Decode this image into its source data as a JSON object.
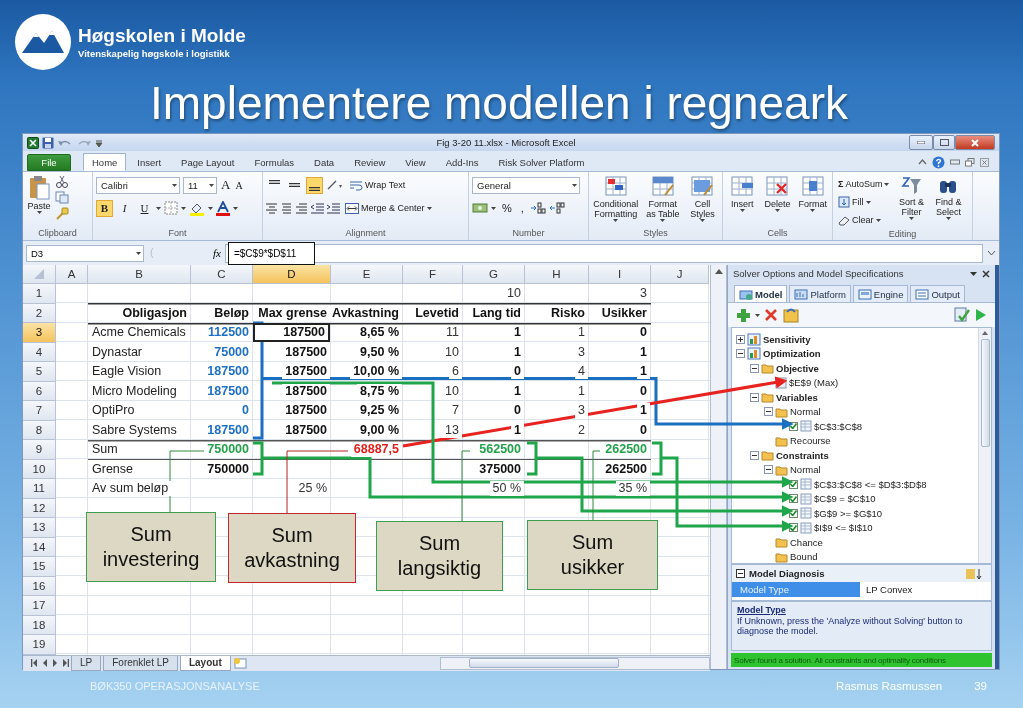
{
  "slide": {
    "org_name": "Høgskolen i Molde",
    "org_tagline": "Vitenskapelig høgskole i logistikk",
    "title": "Implementere modellen i regneark",
    "footer_left": "BØK350 OPERASJONSANALYSE",
    "author": "Rasmus Rasmussen",
    "page": "39"
  },
  "window": {
    "title": "Fig 3-20 11.xlsx - Microsoft Excel"
  },
  "ribbon_tabs": [
    {
      "label": "File",
      "kind": "file"
    },
    {
      "label": "Home",
      "kind": "tab",
      "selected": true
    },
    {
      "label": "Insert",
      "kind": "tab",
      "selected": false
    },
    {
      "label": "Page Layout",
      "kind": "tab",
      "selected": false
    },
    {
      "label": "Formulas",
      "kind": "tab",
      "selected": false
    },
    {
      "label": "Data",
      "kind": "tab",
      "selected": false
    },
    {
      "label": "Review",
      "kind": "tab",
      "selected": false
    },
    {
      "label": "View",
      "kind": "tab",
      "selected": false
    },
    {
      "label": "Add-Ins",
      "kind": "tab",
      "selected": false
    },
    {
      "label": "Risk Solver Platform",
      "kind": "tab",
      "selected": false
    }
  ],
  "ribbon": {
    "groups": [
      {
        "kind": "clipboard",
        "label": "Clipboard",
        "paste": "Paste"
      },
      {
        "kind": "font",
        "label": "Font",
        "font_name": "Calibri",
        "font_size": "11",
        "size_buttons": [
          "A",
          "A"
        ],
        "format_buttons": [
          {
            "label": "B",
            "selected": true
          },
          {
            "label": "I",
            "selected": false
          },
          {
            "label": "U",
            "selected": false
          }
        ]
      },
      {
        "kind": "alignment",
        "label": "Alignment",
        "vertical_align": [
          {
            "selected": false
          },
          {
            "selected": false
          },
          {
            "selected": true
          }
        ],
        "wrap": "Wrap Text",
        "merge": "Merge & Center"
      },
      {
        "kind": "number",
        "label": "Number",
        "format": "General",
        "symbols": [
          "%",
          ","
        ]
      },
      {
        "kind": "styles",
        "label": "Styles",
        "buttons": [
          "Conditional Formatting",
          "Format as Table",
          "Cell Styles"
        ]
      },
      {
        "kind": "cells",
        "label": "Cells",
        "buttons": [
          "Insert",
          "Delete",
          "Format"
        ]
      },
      {
        "kind": "editing",
        "label": "Editing",
        "sum_symbol": "Σ",
        "small_buttons": [
          "AutoSum",
          "Fill",
          "Clear"
        ],
        "buttons": [
          "Sort & Filter",
          "Find & Select"
        ]
      }
    ]
  },
  "formula_bar": {
    "name_box": "D3",
    "function_label": "fx",
    "formula": "=$C$9*$D$11"
  },
  "sheet": {
    "columns": [
      {
        "label": "A",
        "selected": false
      },
      {
        "label": "B",
        "selected": false
      },
      {
        "label": "C",
        "selected": false
      },
      {
        "label": "D",
        "selected": true
      },
      {
        "label": "E",
        "selected": false
      },
      {
        "label": "F",
        "selected": false
      },
      {
        "label": "G",
        "selected": false
      },
      {
        "label": "H",
        "selected": false
      },
      {
        "label": "I",
        "selected": false
      },
      {
        "label": "J",
        "selected": false
      }
    ],
    "rows": [
      {
        "number": "1",
        "selected": false,
        "cells": {
          "G": {
            "text": "10",
            "kind": "num"
          },
          "I": {
            "text": "3",
            "kind": "num"
          }
        }
      },
      {
        "number": "2",
        "selected": false,
        "cells": {
          "B": {
            "text": "Obligasjon",
            "kind": "bold"
          },
          "C": {
            "text": "Beløp",
            "kind": "bold"
          },
          "D": {
            "text": "Max grense",
            "kind": "bold"
          },
          "E": {
            "text": "Avkastning",
            "kind": "bold"
          },
          "F": {
            "text": "Levetid",
            "kind": "bold"
          },
          "G": {
            "text": "Lang tid",
            "kind": "bold"
          },
          "H": {
            "text": "Risko",
            "kind": "bold"
          },
          "I": {
            "text": "Usikker",
            "kind": "bold"
          }
        }
      },
      {
        "number": "3",
        "selected": true,
        "cells": {
          "B": {
            "text": "Acme Chemicals",
            "kind": "text"
          },
          "C": {
            "text": "112500",
            "kind": "input"
          },
          "D": {
            "text": "187500",
            "kind": "bold",
            "selected": true
          },
          "E": {
            "text": "8,65 %",
            "kind": "bold"
          },
          "F": {
            "text": "11",
            "kind": "num"
          },
          "G": {
            "text": "1",
            "kind": "bold"
          },
          "H": {
            "text": "1",
            "kind": "num"
          },
          "I": {
            "text": "0",
            "kind": "bold"
          }
        }
      },
      {
        "number": "4",
        "selected": false,
        "cells": {
          "B": {
            "text": "Dynastar",
            "kind": "text"
          },
          "C": {
            "text": "75000",
            "kind": "input"
          },
          "D": {
            "text": "187500",
            "kind": "bold"
          },
          "E": {
            "text": "9,50 %",
            "kind": "bold"
          },
          "F": {
            "text": "10",
            "kind": "num"
          },
          "G": {
            "text": "1",
            "kind": "bold"
          },
          "H": {
            "text": "3",
            "kind": "num"
          },
          "I": {
            "text": "1",
            "kind": "bold"
          }
        }
      },
      {
        "number": "5",
        "selected": false,
        "cells": {
          "B": {
            "text": "Eagle Vision",
            "kind": "text"
          },
          "C": {
            "text": "187500",
            "kind": "input"
          },
          "D": {
            "text": "187500",
            "kind": "bold"
          },
          "E": {
            "text": "10,00 %",
            "kind": "bold"
          },
          "F": {
            "text": "6",
            "kind": "num"
          },
          "G": {
            "text": "0",
            "kind": "bold"
          },
          "H": {
            "text": "4",
            "kind": "num"
          },
          "I": {
            "text": "1",
            "kind": "bold"
          }
        }
      },
      {
        "number": "6",
        "selected": false,
        "cells": {
          "B": {
            "text": "Micro Modeling",
            "kind": "text"
          },
          "C": {
            "text": "187500",
            "kind": "input"
          },
          "D": {
            "text": "187500",
            "kind": "bold"
          },
          "E": {
            "text": "8,75 %",
            "kind": "bold"
          },
          "F": {
            "text": "10",
            "kind": "num"
          },
          "G": {
            "text": "1",
            "kind": "bold"
          },
          "H": {
            "text": "1",
            "kind": "num"
          },
          "I": {
            "text": "0",
            "kind": "bold"
          }
        }
      },
      {
        "number": "7",
        "selected": false,
        "cells": {
          "B": {
            "text": "OptiPro",
            "kind": "text"
          },
          "C": {
            "text": "0",
            "kind": "input"
          },
          "D": {
            "text": "187500",
            "kind": "bold"
          },
          "E": {
            "text": "9,25 %",
            "kind": "bold"
          },
          "F": {
            "text": "7",
            "kind": "num"
          },
          "G": {
            "text": "0",
            "kind": "bold"
          },
          "H": {
            "text": "3",
            "kind": "num"
          },
          "I": {
            "text": "1",
            "kind": "bold"
          }
        }
      },
      {
        "number": "8",
        "selected": false,
        "cells": {
          "B": {
            "text": "Sabre Systems",
            "kind": "text"
          },
          "C": {
            "text": "187500",
            "kind": "input"
          },
          "D": {
            "text": "187500",
            "kind": "bold"
          },
          "E": {
            "text": "9,00 %",
            "kind": "bold"
          },
          "F": {
            "text": "13",
            "kind": "num"
          },
          "G": {
            "text": "1",
            "kind": "bold"
          },
          "H": {
            "text": "2",
            "kind": "num"
          },
          "I": {
            "text": "0",
            "kind": "bold"
          }
        }
      },
      {
        "number": "9",
        "selected": false,
        "cells": {
          "B": {
            "text": "Sum",
            "kind": "text"
          },
          "C": {
            "text": "750000",
            "kind": "sum"
          },
          "E": {
            "text": "68887,5",
            "kind": "objective"
          },
          "G": {
            "text": "562500",
            "kind": "sum"
          },
          "I": {
            "text": "262500",
            "kind": "sum"
          }
        }
      },
      {
        "number": "10",
        "selected": false,
        "cells": {
          "B": {
            "text": "Grense",
            "kind": "text"
          },
          "C": {
            "text": "750000",
            "kind": "bold"
          },
          "G": {
            "text": "375000",
            "kind": "bold"
          },
          "I": {
            "text": "262500",
            "kind": "bold"
          }
        }
      },
      {
        "number": "11",
        "selected": false,
        "cells": {
          "B": {
            "text": "Av sum beløp",
            "kind": "text"
          },
          "D": {
            "text": "25 %",
            "kind": "num"
          },
          "G": {
            "text": "50 %",
            "kind": "num"
          },
          "I": {
            "text": "35 %",
            "kind": "num"
          }
        }
      },
      {
        "number": "12",
        "selected": false
      },
      {
        "number": "13",
        "selected": false
      },
      {
        "number": "14",
        "selected": false
      },
      {
        "number": "15",
        "selected": false
      },
      {
        "number": "16",
        "selected": false
      },
      {
        "number": "17",
        "selected": false
      },
      {
        "number": "18",
        "selected": false
      },
      {
        "number": "19",
        "selected": false
      }
    ],
    "tabs": [
      {
        "label": "LP",
        "selected": false
      },
      {
        "label": "Forenklet LP",
        "selected": false
      },
      {
        "label": "Layout",
        "selected": true
      }
    ]
  },
  "callouts": [
    {
      "text": "Sum\ninvestering",
      "color": "#3f9f50"
    },
    {
      "text": "Sum\navkastning",
      "color": "#c0262c"
    },
    {
      "text": "Sum\nlangsiktig",
      "color": "#3f9f50"
    },
    {
      "text": "Sum\nusikker",
      "color": "#3f9f50"
    }
  ],
  "solver_pane": {
    "title": "Solver Options and Model Specifications",
    "tabs": [
      {
        "label": "Model",
        "selected": true
      },
      {
        "label": "Platform",
        "selected": false
      },
      {
        "label": "Engine",
        "selected": false
      },
      {
        "label": "Output",
        "selected": false
      }
    ],
    "tree": [
      {
        "label": "Sensitivity",
        "kind": "section",
        "expanded": false
      },
      {
        "label": "Optimization",
        "kind": "section",
        "expanded": true,
        "children": [
          {
            "label": "Objective",
            "kind": "group",
            "expanded": true,
            "children": [
              {
                "label": "$E$9 (Max)",
                "kind": "objective"
              }
            ]
          },
          {
            "label": "Variables",
            "kind": "group",
            "expanded": true,
            "children": [
              {
                "label": "Normal",
                "kind": "folder",
                "expanded": true,
                "children": [
                  {
                    "label": "$C$3:$C$8",
                    "kind": "cell",
                    "checked": true
                  }
                ]
              },
              {
                "label": "Recourse",
                "kind": "folder"
              }
            ]
          },
          {
            "label": "Constraints",
            "kind": "group",
            "expanded": true,
            "children": [
              {
                "label": "Normal",
                "kind": "folder",
                "expanded": true,
                "children": [
                  {
                    "label": "$C$3:$C$8 <= $D$3:$D$8",
                    "kind": "cell",
                    "checked": true
                  },
                  {
                    "label": "$C$9 = $C$10",
                    "kind": "cell",
                    "checked": true
                  },
                  {
                    "label": "$G$9 >= $G$10",
                    "kind": "cell",
                    "checked": true
                  },
                  {
                    "label": "$I$9 <= $I$10",
                    "kind": "cell",
                    "checked": true
                  }
                ]
              },
              {
                "label": "Chance",
                "kind": "folder"
              },
              {
                "label": "Bound",
                "kind": "folder"
              }
            ]
          }
        ]
      }
    ],
    "diagnosis": {
      "title": "Model Diagnosis",
      "property": "Model Type",
      "value": "LP Convex",
      "selected": true
    },
    "help": {
      "title": "Model Type",
      "text": "If Unknown, press the 'Analyze without Solving' button to diagnose the model."
    },
    "status": "Solver found a solution.  All constraints and optimality conditions"
  }
}
